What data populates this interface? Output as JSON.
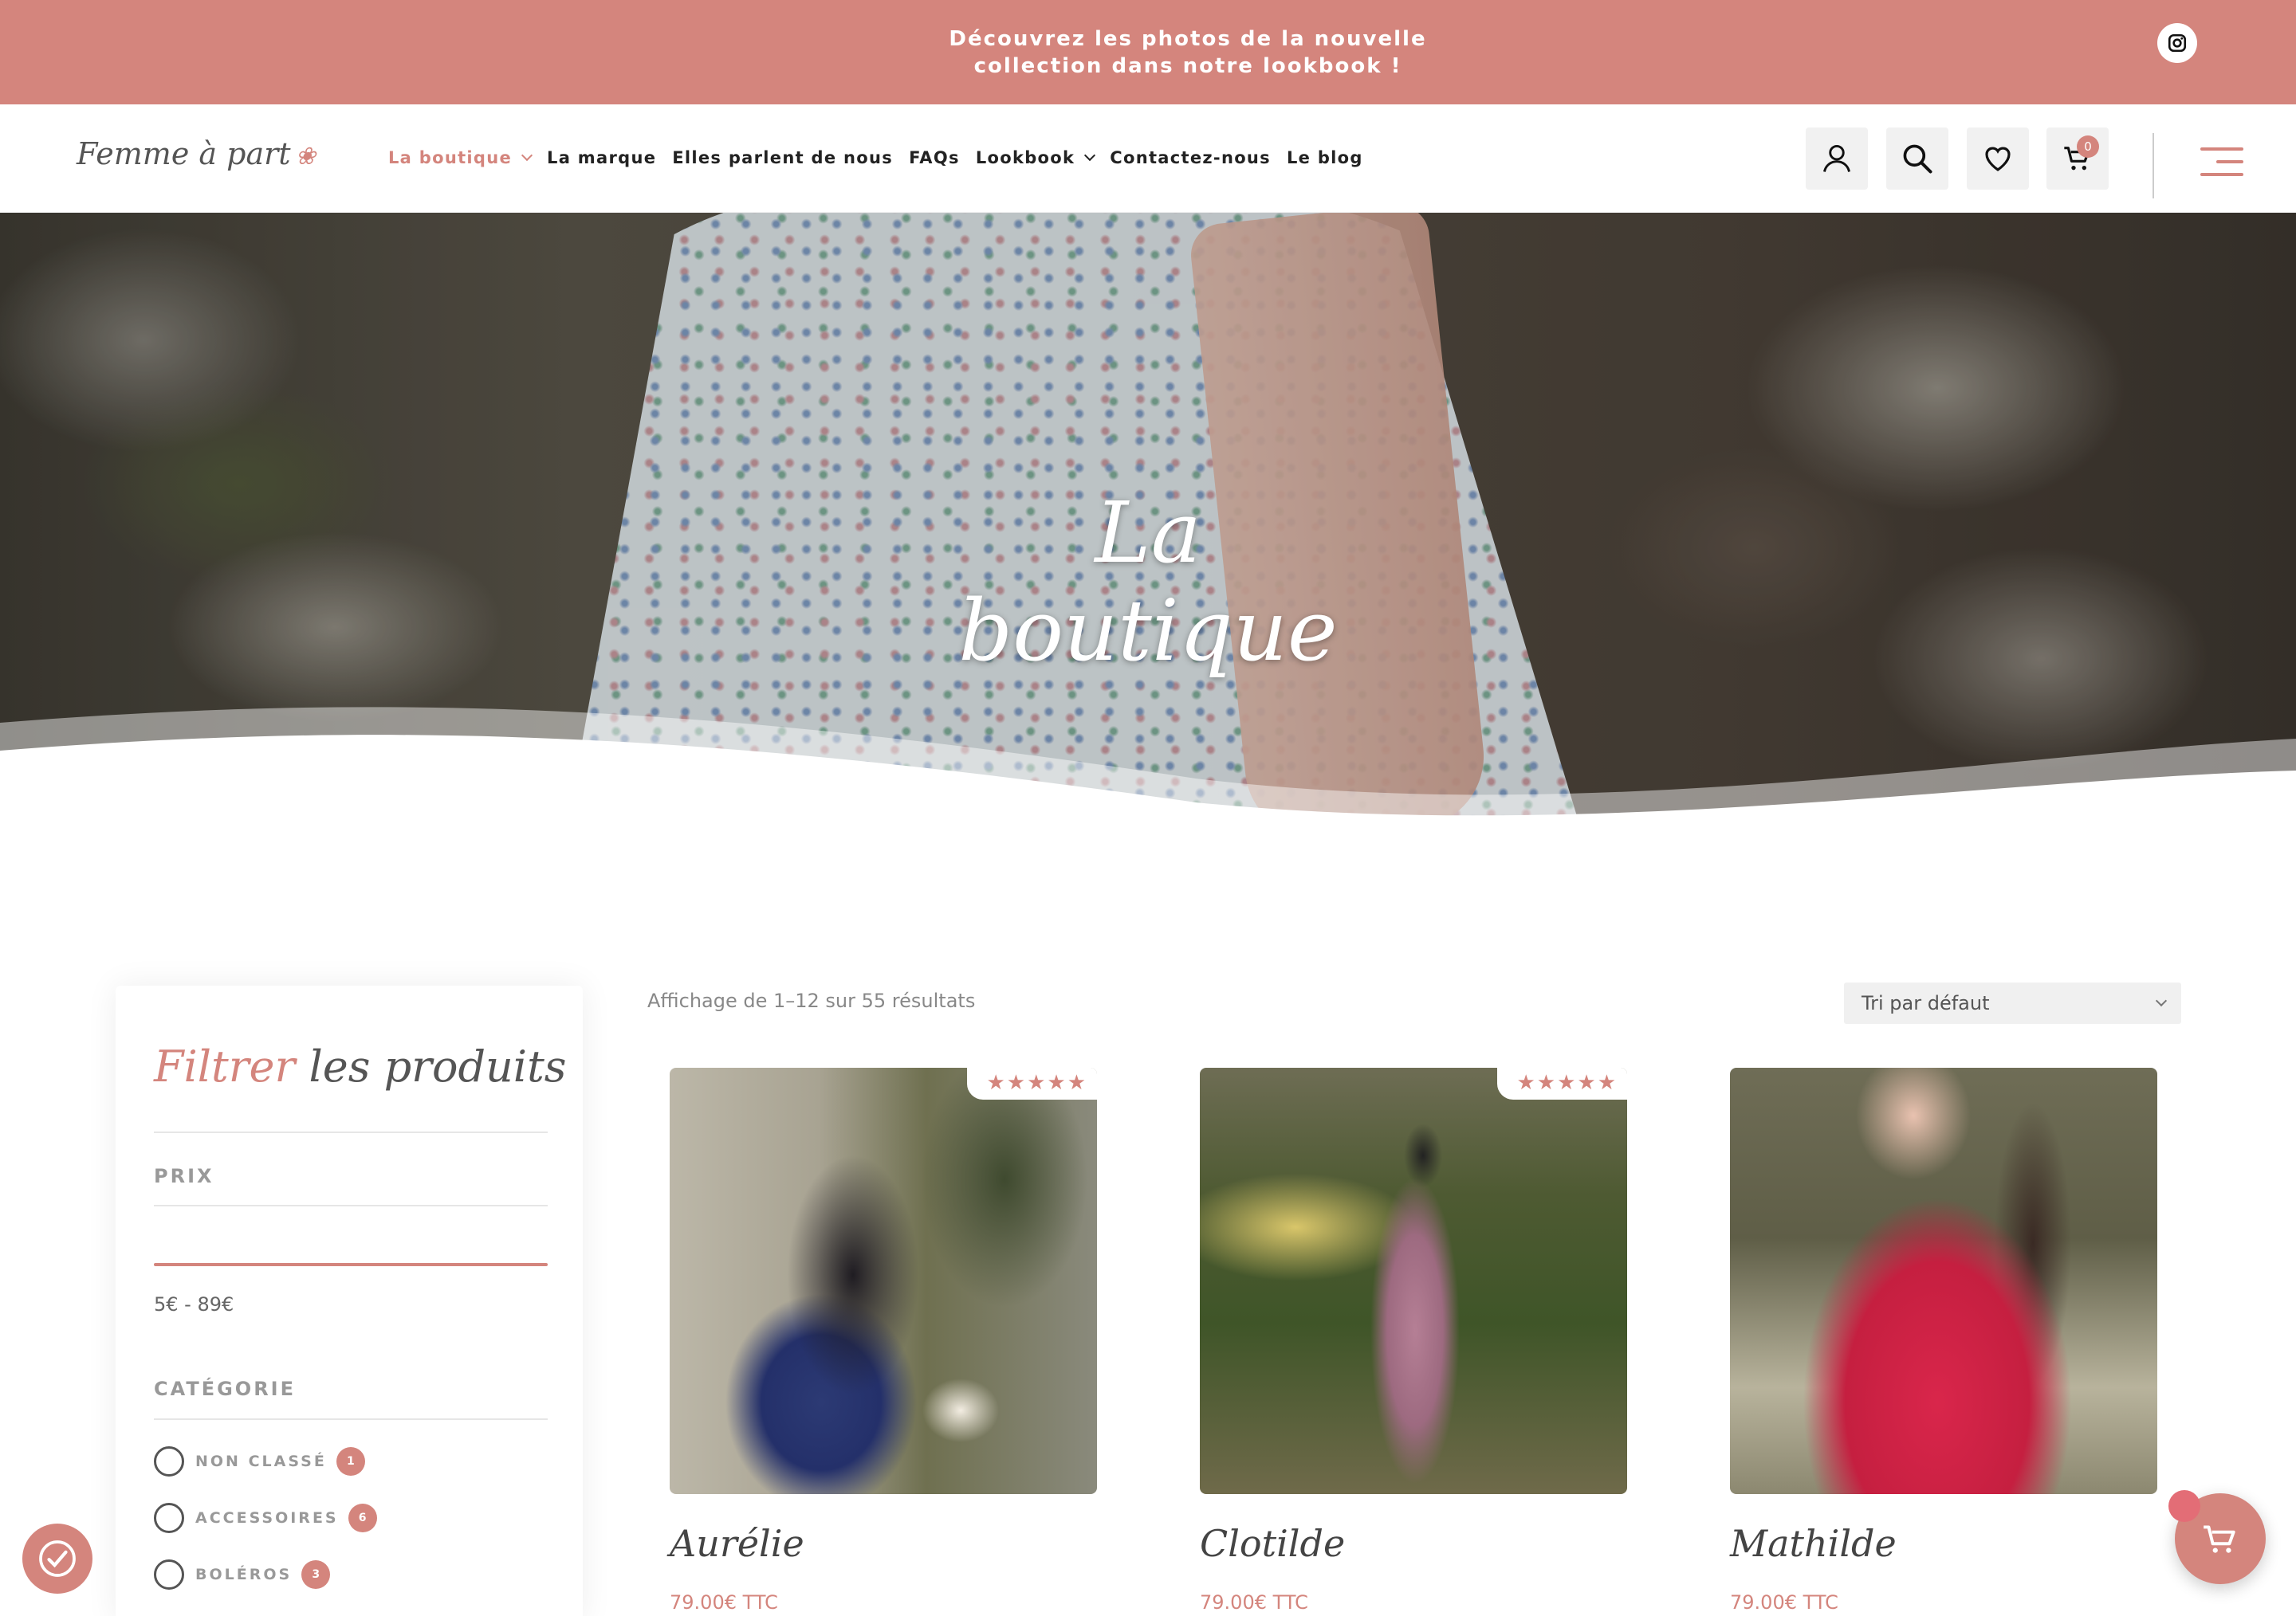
{
  "announcement": {
    "line1": "Découvrez les photos de la nouvelle",
    "line2": "collection dans notre lookbook !",
    "social_icon": "instagram-icon"
  },
  "header": {
    "logo_text": "Femme à part",
    "nav": [
      {
        "label": "La boutique",
        "has_dropdown": true,
        "active": true
      },
      {
        "label": "La marque",
        "has_dropdown": false
      },
      {
        "label": "Elles parlent de nous",
        "has_dropdown": false
      },
      {
        "label": "FAQs",
        "has_dropdown": false
      },
      {
        "label": "Lookbook",
        "has_dropdown": true
      },
      {
        "label": "Contactez-nous",
        "has_dropdown": false
      },
      {
        "label": "Le blog",
        "has_dropdown": false
      }
    ],
    "icons": [
      "account-icon",
      "search-icon",
      "heart-icon",
      "cart-icon",
      "menu-icon"
    ],
    "cart_count": "0"
  },
  "hero": {
    "title": "La boutique"
  },
  "sidebar": {
    "title_accent": "Filtrer",
    "title_rest": "les produits",
    "price_heading": "PRIX",
    "price_range": "5€ - 89€",
    "category_heading": "CATÉGORIE",
    "categories": [
      {
        "label": "NON CLASSÉ",
        "count": "1"
      },
      {
        "label": "ACCESSOIRES",
        "count": "6"
      },
      {
        "label": "BOLÉROS",
        "count": "3"
      }
    ]
  },
  "results": {
    "count_text": "Affichage de 1–12 sur 55 résultats",
    "sort_selected": "Tri par défaut"
  },
  "products": [
    {
      "name": "Aurélie",
      "price": "79.00€ TTC",
      "rating": 5,
      "stars": "★★★★★"
    },
    {
      "name": "Clotilde",
      "price": "79.00€ TTC",
      "rating": 5,
      "stars": "★★★★★"
    },
    {
      "name": "Mathilde",
      "price": "79.00€ TTC",
      "rating": null
    }
  ],
  "colors": {
    "accent": "#d4857d",
    "announcement_bg": "#d4857d"
  }
}
